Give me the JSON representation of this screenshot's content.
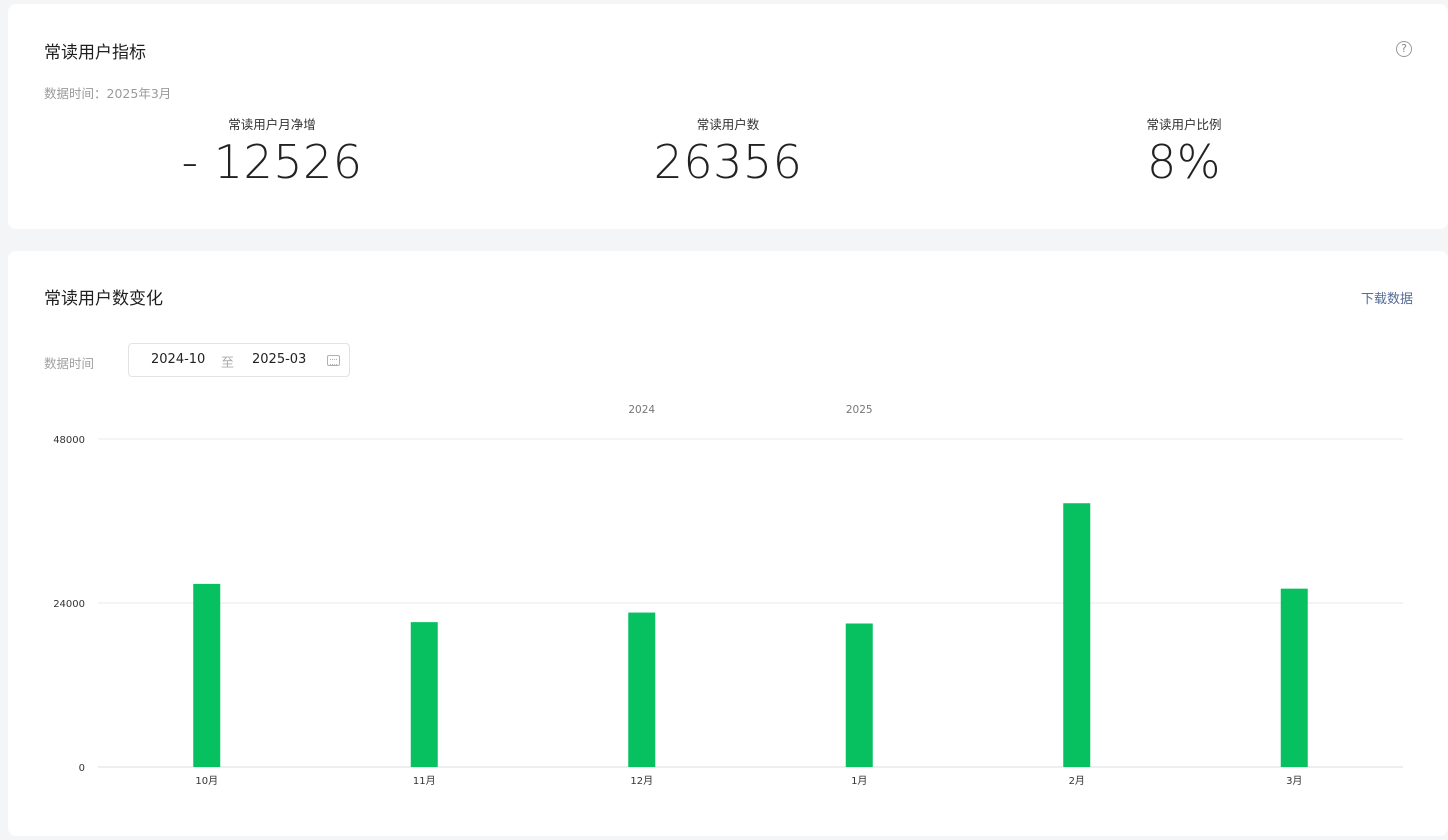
{
  "metrics_card": {
    "title": "常读用户指标",
    "help_icon": "question-circle-icon",
    "data_time_label": "数据时间：",
    "data_time_value": "2025年3月",
    "metrics": [
      {
        "label": "常读用户月净增",
        "value": "- 12526"
      },
      {
        "label": "常读用户数",
        "value": "26356"
      },
      {
        "label": "常读用户比例",
        "value": "8%"
      }
    ]
  },
  "chart_card": {
    "title": "常读用户数变化",
    "download_label": "下载数据",
    "filter_label": "数据时间",
    "date_start": "2024-10",
    "date_separator": "至",
    "date_end": "2025-03",
    "calendar_icon": "calendar-icon"
  },
  "colors": {
    "bar": "#07c160",
    "link": "#576b95",
    "grid": "#e8e8e8"
  },
  "chart_data": {
    "type": "bar",
    "categories": [
      "10月",
      "11月",
      "12月",
      "1月",
      "2月",
      "3月"
    ],
    "values": [
      26800,
      21200,
      22600,
      21000,
      38600,
      26100
    ],
    "year_labels": [
      {
        "label": "2024",
        "at_category": "12月"
      },
      {
        "label": "2025",
        "at_category": "1月"
      }
    ],
    "y_ticks": [
      "0",
      "24000",
      "48000"
    ],
    "ylim": [
      0,
      48000
    ],
    "grid": true,
    "legend": false,
    "xlabel": "",
    "ylabel": ""
  }
}
